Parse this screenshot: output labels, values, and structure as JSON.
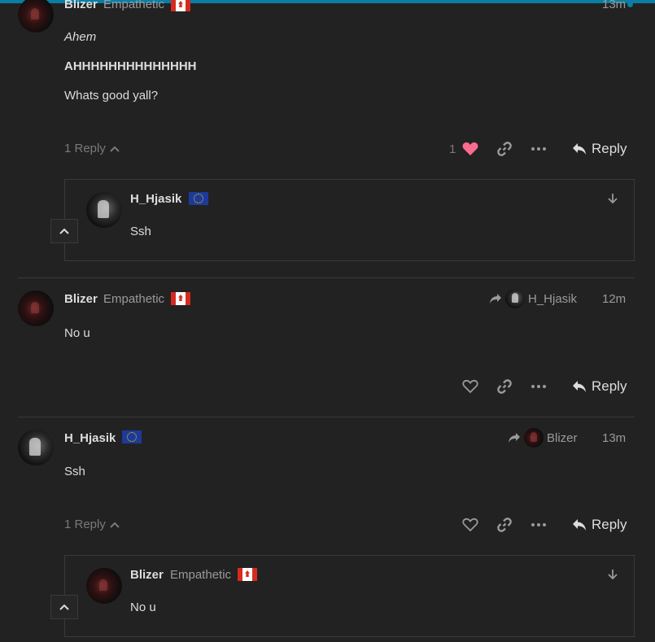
{
  "posts": [
    {
      "username": "Blizer",
      "user_title": "Empathetic",
      "time": "13m",
      "lines": [
        "Ahem",
        "AHHHHHHHHHHHHHH",
        "Whats good yall?"
      ],
      "replies_label": "1 Reply",
      "like_count": "1",
      "reply_label": "Reply",
      "embedded": {
        "username": "H_Hjasik",
        "text": "Ssh"
      }
    },
    {
      "username": "Blizer",
      "user_title": "Empathetic",
      "time": "12m",
      "reply_to": "H_Hjasik",
      "text": "No u",
      "reply_label": "Reply"
    },
    {
      "username": "H_Hjasik",
      "time": "13m",
      "reply_to": "Blizer",
      "text": "Ssh",
      "replies_label": "1 Reply",
      "reply_label": "Reply",
      "embedded": {
        "username": "Blizer",
        "user_title": "Empathetic",
        "text": "No u"
      }
    }
  ],
  "colors": {
    "accent": "#0a7ea4",
    "heart": "#fa6c8d",
    "background": "#222222"
  }
}
